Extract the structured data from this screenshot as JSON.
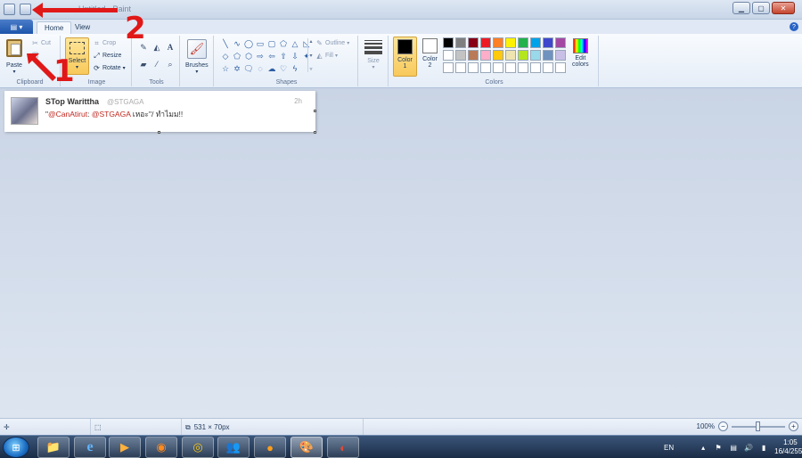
{
  "window": {
    "title": "Untitled - Paint"
  },
  "tabs": {
    "file_tab_label": "▤ ▾",
    "home": "Home",
    "view": "View"
  },
  "ribbon": {
    "clipboard": {
      "label": "Clipboard",
      "paste": "Paste",
      "cut": "Cut"
    },
    "image": {
      "label": "Image",
      "select": "Select",
      "crop": "Crop",
      "resize": "Resize",
      "rotate": "Rotate"
    },
    "tools": {
      "label": "Tools"
    },
    "brushes": {
      "label": "Brushes"
    },
    "shapes": {
      "label": "Shapes",
      "outline": "Outline",
      "fill": "Fill"
    },
    "size": {
      "label": "Size"
    },
    "colors": {
      "label": "Colors",
      "color1": "Color\n1",
      "color1_line1": "Color",
      "color1_line2": "1",
      "color2_line1": "Color",
      "color2_line2": "2",
      "edit_line1": "Edit",
      "edit_line2": "colors",
      "color1_value": "#000000",
      "color2_value": "#ffffff",
      "palette": [
        "#000000",
        "#7f7f7f",
        "#880015",
        "#ed1c24",
        "#ff7f27",
        "#fff200",
        "#22b14c",
        "#00a2e8",
        "#3f48cc",
        "#a349a4",
        "#ffffff",
        "#c3c3c3",
        "#b97a57",
        "#ffaec9",
        "#ffc90e",
        "#efe4b0",
        "#b5e61d",
        "#99d9ea",
        "#7092be",
        "#c8bfe7",
        "#ffffff",
        "#ffffff",
        "#ffffff",
        "#ffffff",
        "#ffffff",
        "#ffffff",
        "#ffffff",
        "#ffffff",
        "#ffffff",
        "#ffffff"
      ]
    }
  },
  "canvas": {
    "tweet": {
      "name": "STop Warittha",
      "handle": "@STGAGA",
      "time": "2h",
      "quote_open": "\"",
      "mention1": "@CanAtirut",
      "colon": ": ",
      "mention2": "@STGAGA",
      "rest": " เหอะ\"/ ทำไมม!!"
    }
  },
  "status": {
    "dimensions": "531 × 70px",
    "zoom": "100%"
  },
  "taskbar": {
    "language": "EN",
    "time": "1:05",
    "date": "16/4/2555"
  },
  "annotations": {
    "one": "1",
    "two": "2"
  }
}
